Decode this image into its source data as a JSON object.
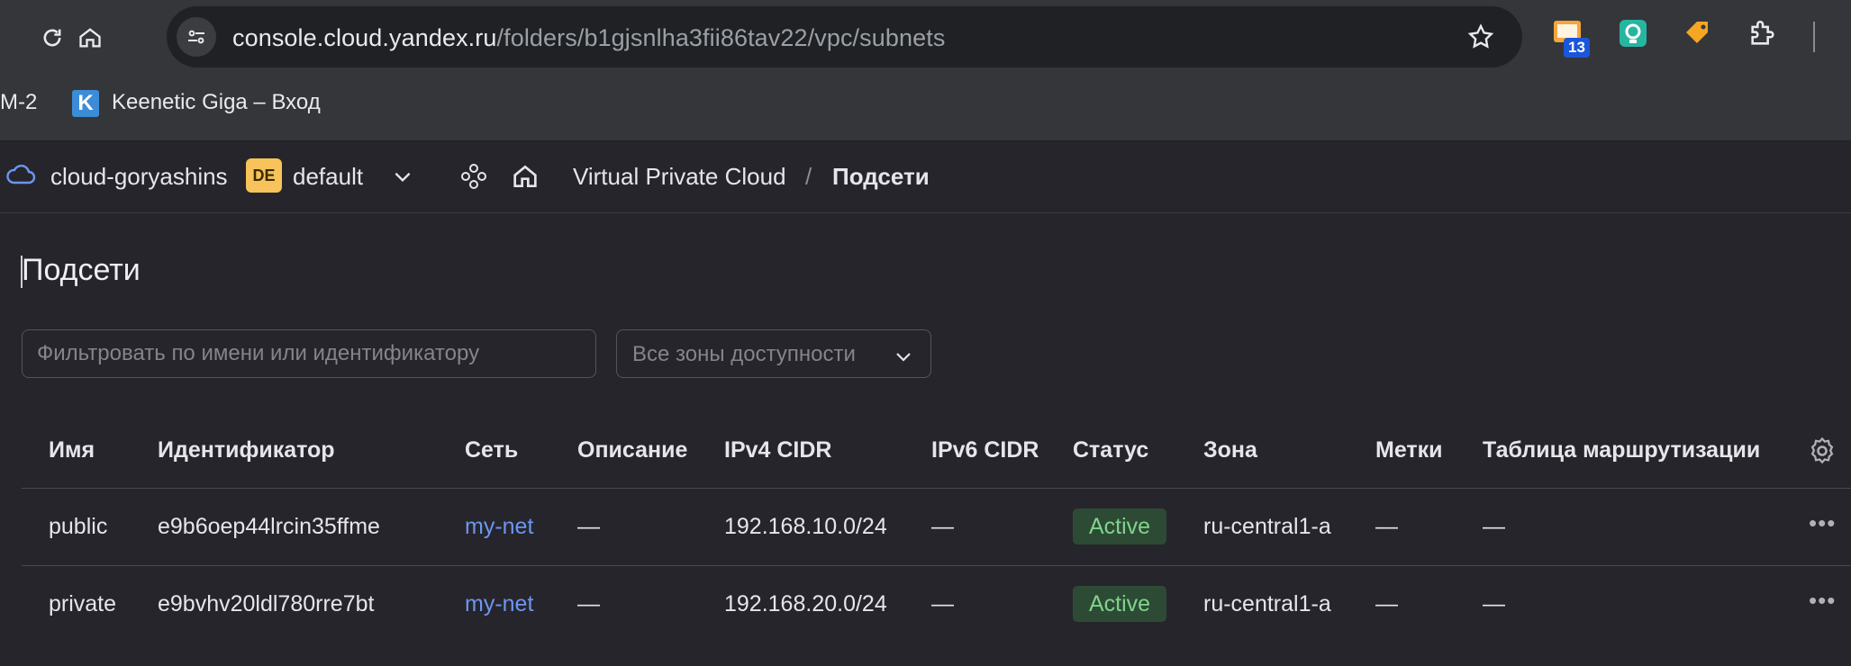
{
  "browser": {
    "url_host": "console.cloud.yandex.ru",
    "url_path": "/folders/b1gjsnlha3fii86tav22/vpc/subnets",
    "extension_badge": "13",
    "bookmarks": [
      {
        "label": "M-2"
      },
      {
        "label": "Keenetic Giga – Вход"
      }
    ]
  },
  "header": {
    "cloud_name": "cloud-goryashins",
    "folder_badge": "DE",
    "folder_name": "default",
    "breadcrumb_service": "Virtual Private Cloud",
    "breadcrumb_sep": "/",
    "breadcrumb_current": "Подсети"
  },
  "page": {
    "title": "Подсети",
    "filter_placeholder": "Фильтровать по имени или идентификатору",
    "zone_select": "Все зоны доступности"
  },
  "table": {
    "columns": [
      "Имя",
      "Идентификатор",
      "Сеть",
      "Описание",
      "IPv4 CIDR",
      "IPv6 CIDR",
      "Статус",
      "Зона",
      "Метки",
      "Таблица маршрутизации"
    ],
    "rows": [
      {
        "name": "public",
        "id": "e9b6oep44lrcin35ffme",
        "network": "my-net",
        "description": "—",
        "ipv4": "192.168.10.0/24",
        "ipv6": "—",
        "status": "Active",
        "zone": "ru-central1-a",
        "labels": "—",
        "route_table": "—"
      },
      {
        "name": "private",
        "id": "e9bvhv20ldl780rre7bt",
        "network": "my-net",
        "description": "—",
        "ipv4": "192.168.20.0/24",
        "ipv6": "—",
        "status": "Active",
        "zone": "ru-central1-a",
        "labels": "—",
        "route_table": "—"
      }
    ]
  },
  "colors": {
    "accent_link": "#6d95f2",
    "status_active_bg": "#2d4a35",
    "status_active_text": "#7fd48b",
    "folder_badge": "#f8c35a"
  }
}
